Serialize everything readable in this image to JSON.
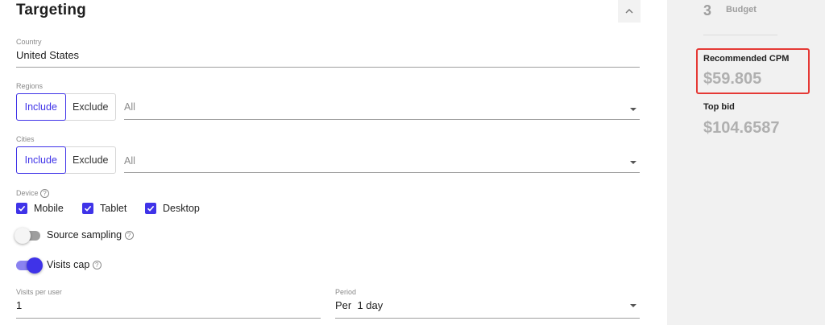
{
  "section": {
    "title": "Targeting"
  },
  "country": {
    "label": "Country",
    "value": "United States"
  },
  "regions": {
    "label": "Regions",
    "include_label": "Include",
    "exclude_label": "Exclude",
    "select_value": "All"
  },
  "cities": {
    "label": "Cities",
    "include_label": "Include",
    "exclude_label": "Exclude",
    "select_value": "All"
  },
  "device": {
    "label": "Device",
    "help_glyph": "?",
    "options": [
      {
        "label": "Mobile",
        "checked": true
      },
      {
        "label": "Tablet",
        "checked": true
      },
      {
        "label": "Desktop",
        "checked": true
      }
    ]
  },
  "source_sampling": {
    "label": "Source sampling",
    "help_glyph": "?",
    "on": false
  },
  "visits_cap": {
    "label": "Visits cap",
    "help_glyph": "?",
    "on": true
  },
  "visits_per_user": {
    "label": "Visits per user",
    "value": "1"
  },
  "period": {
    "label": "Period",
    "value": "Per  1 day"
  },
  "sidebar": {
    "step_number": "3",
    "step_label": "Budget",
    "recommended_cpm_label": "Recommended CPM",
    "recommended_cpm_value": "$59.805",
    "top_bid_label": "Top bid",
    "top_bid_value": "$104.6587"
  },
  "colors": {
    "accent": "#3f33e8",
    "toggle_on_track": "#8a82f0",
    "toggle_off_track": "#9e9e9e",
    "highlight": "#e53935",
    "sidebar_bg": "#f1f1f1"
  },
  "icons": {
    "collapse": "chevron-up-icon",
    "help": "help-circle-icon",
    "check": "check-icon",
    "dropdown": "caret-down-icon"
  }
}
